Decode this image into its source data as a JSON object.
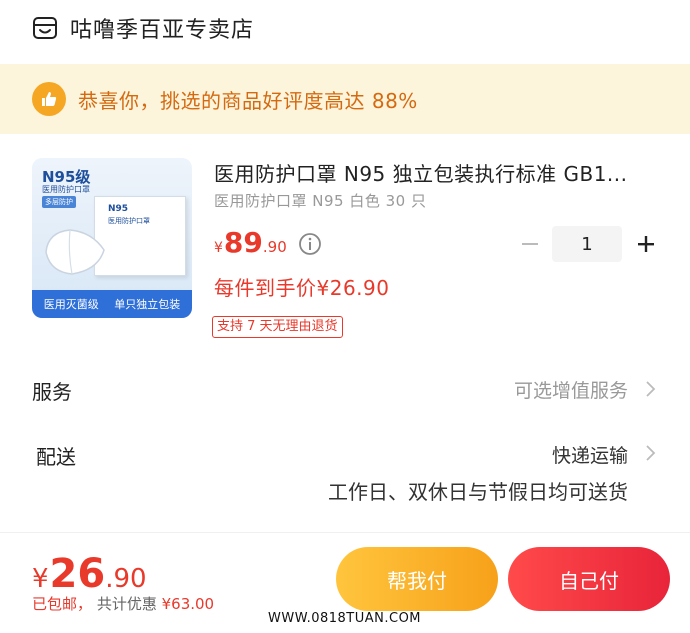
{
  "store": {
    "name": "咕噜季百亚专卖店",
    "icon": "store-icon"
  },
  "notice": {
    "text": "恭喜你，挑选的商品好评度高达 88%",
    "icon": "thumbs-up-icon"
  },
  "product": {
    "title": "医用防护口罩 N95 独立包装执行标准 GB1...",
    "spec": "医用防护口罩 N95 白色 30 只",
    "price": {
      "currency": "¥",
      "integer": "89",
      "decimal": ".90"
    },
    "quantity": "1",
    "each_price": "每件到手价¥26.90",
    "return_policy": "支持 7 天无理由退货",
    "image": {
      "badge": "N95级",
      "badge_sub": "医用防护口罩",
      "tag": "多层防护",
      "box_title": "N95",
      "box_sub": "医用防护口罩",
      "bar_left": "医用灭菌级",
      "bar_right": "单只独立包装"
    }
  },
  "service": {
    "label": "服务",
    "value": "可选增值服务"
  },
  "delivery": {
    "label": "配送",
    "value": "快递运输",
    "sub": "工作日、双休日与节假日均可送货"
  },
  "footer": {
    "total": {
      "currency": "¥",
      "integer": "26",
      "decimal": ".90"
    },
    "shipping": "已包邮",
    "separator": "，",
    "discount_label": "共计优惠",
    "discount_value": "¥63.00",
    "help_button": "帮我付",
    "pay_button": "自己付",
    "watermark": "WWW.0818TUAN.COM"
  },
  "colors": {
    "accent": "#e8392b",
    "notice_bg": "#fdf4dc",
    "notice_text": "#d46a10",
    "help_button": "#f7a11a",
    "pay_button": "#e8243a"
  }
}
